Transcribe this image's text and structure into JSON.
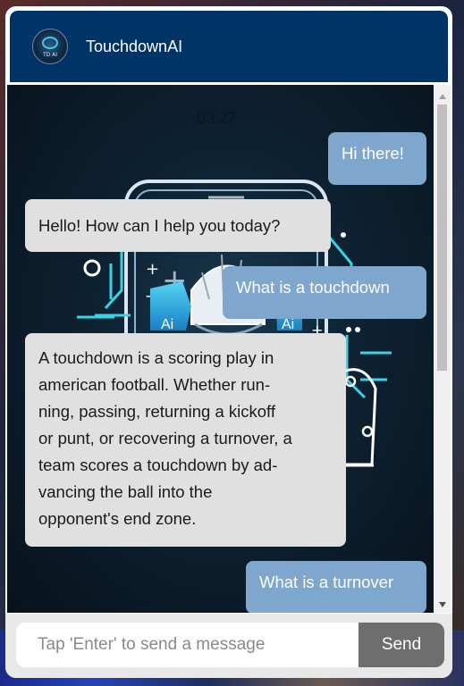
{
  "header": {
    "title": "TouchdownAI",
    "avatar_text": "TD AI"
  },
  "chat": {
    "timestamp": "03:27",
    "messages": [
      {
        "role": "user",
        "text": "Hi there!"
      },
      {
        "role": "bot",
        "text": "Hello! How can I help you today?"
      },
      {
        "role": "user",
        "text": "What is a touchdown"
      },
      {
        "role": "bot",
        "lines": [
          "A touchdown is a scoring play in",
          "american football. Whether run-",
          "ning, passing, returning a kickoff",
          "or punt, or recovering a turnover, a",
          "team scores a touchdown by ad-",
          "vancing the ball into the",
          "opponent's end zone."
        ]
      },
      {
        "role": "user",
        "text": "What is a turnover"
      }
    ],
    "background_labels": [
      "Ai",
      "Ai"
    ]
  },
  "composer": {
    "placeholder": "Tap 'Enter' to send a message",
    "send_label": "Send"
  },
  "colors": {
    "header_bg": "#003366",
    "user_bubble": "#7fa6cc",
    "bot_bubble": "#e0e0e0",
    "send_button": "#6e6e6e"
  },
  "icons": {
    "avatar": "football-helmet-logo-icon",
    "scroll_up": "scroll-up-arrow-icon",
    "scroll_down": "scroll-down-arrow-icon"
  }
}
